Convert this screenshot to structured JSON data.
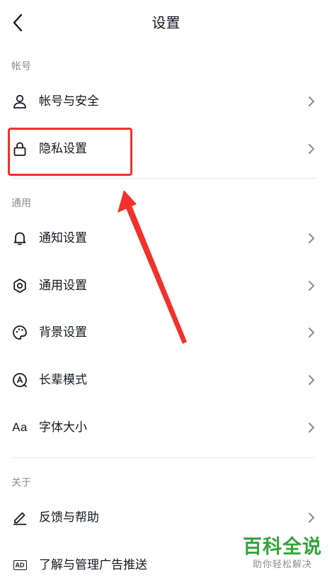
{
  "header": {
    "title": "设置"
  },
  "sections": [
    {
      "label": "帐号",
      "items": [
        {
          "label": "帐号与安全",
          "icon": "user-icon"
        },
        {
          "label": "隐私设置",
          "icon": "lock-icon"
        }
      ]
    },
    {
      "label": "通用",
      "items": [
        {
          "label": "通知设置",
          "icon": "bell-icon"
        },
        {
          "label": "通用设置",
          "icon": "gear-icon"
        },
        {
          "label": "背景设置",
          "icon": "palette-icon"
        },
        {
          "label": "长辈模式",
          "icon": "elder-mode-icon"
        },
        {
          "label": "字体大小",
          "icon": "font-size-icon",
          "icon_text": "Aa"
        }
      ]
    },
    {
      "label": "关于",
      "items": [
        {
          "label": "反馈与帮助",
          "icon": "edit-icon"
        },
        {
          "label": "了解与管理广告推送",
          "icon": "ad-icon",
          "icon_text": "AD"
        }
      ]
    }
  ],
  "annotation": {
    "highlight_color": "#f0312c"
  },
  "watermark": {
    "main": "百科全说",
    "sub": "助你轻松解决",
    "main_color": "#33a53a"
  },
  "colors": {
    "text": "#161823",
    "secondary_text": "#8a8b91",
    "chevron": "#8a8b91",
    "divider": "#ececec"
  }
}
